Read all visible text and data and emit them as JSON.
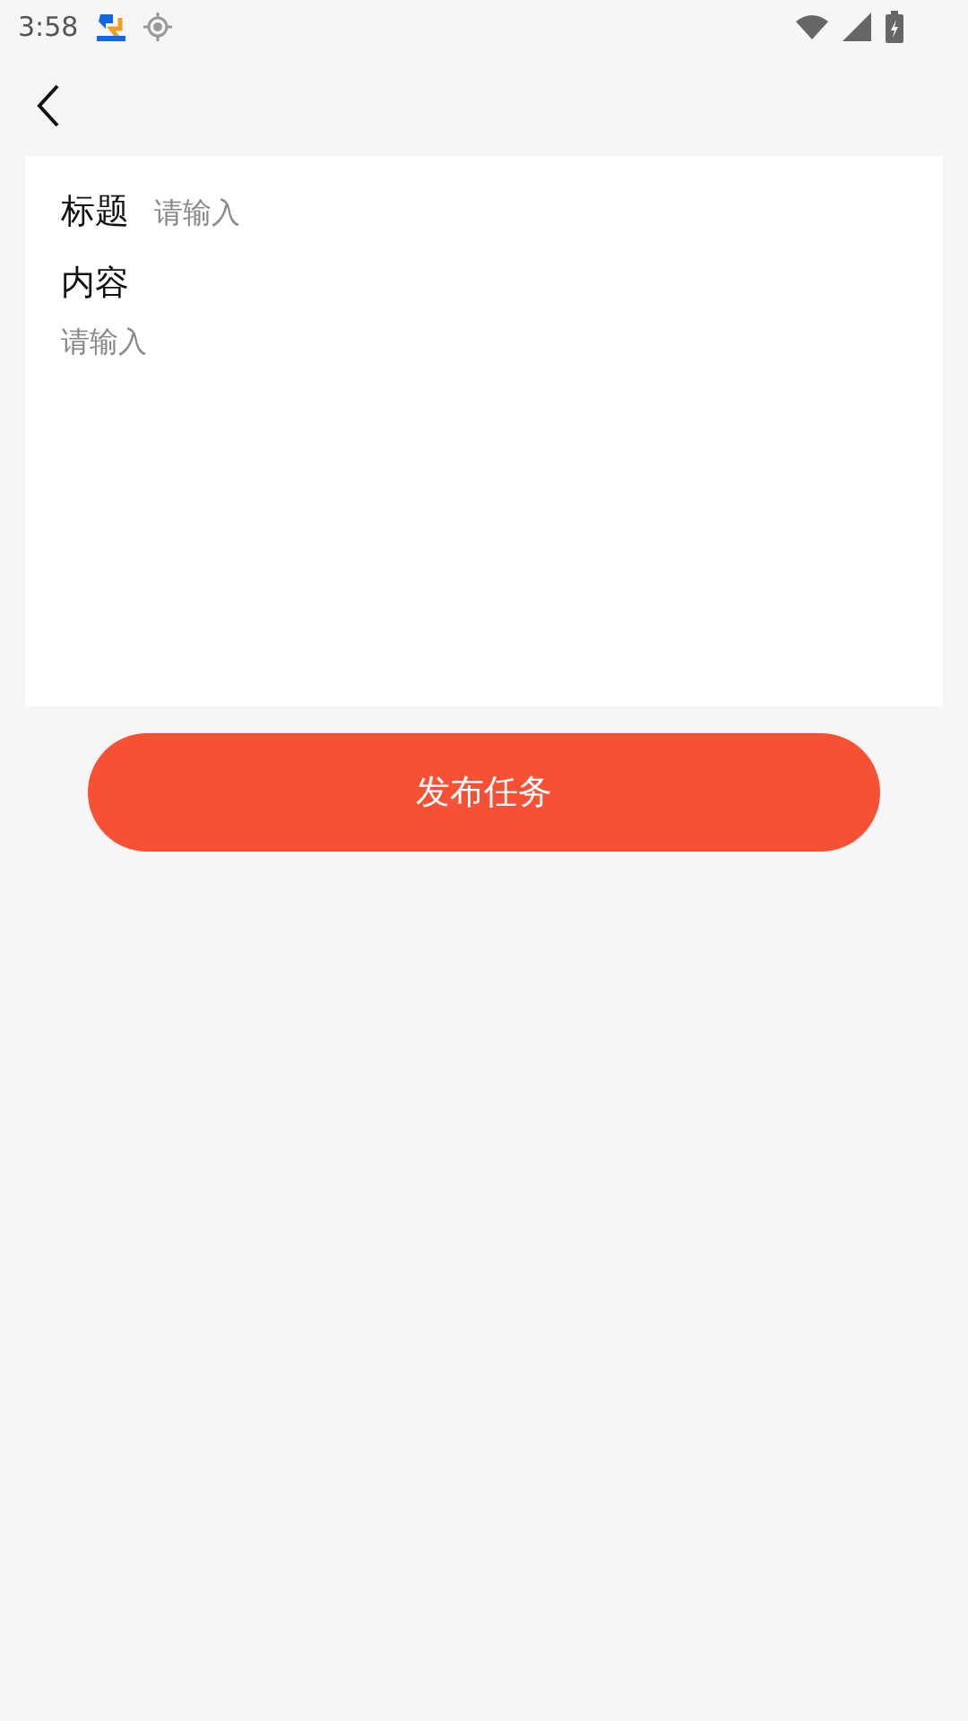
{
  "status_bar": {
    "time": "3:58"
  },
  "form": {
    "title_field": {
      "label": "标题",
      "placeholder": "请输入"
    },
    "content_field": {
      "label": "内容",
      "placeholder": "请输入"
    }
  },
  "submit_button": {
    "label": "发布任务"
  }
}
